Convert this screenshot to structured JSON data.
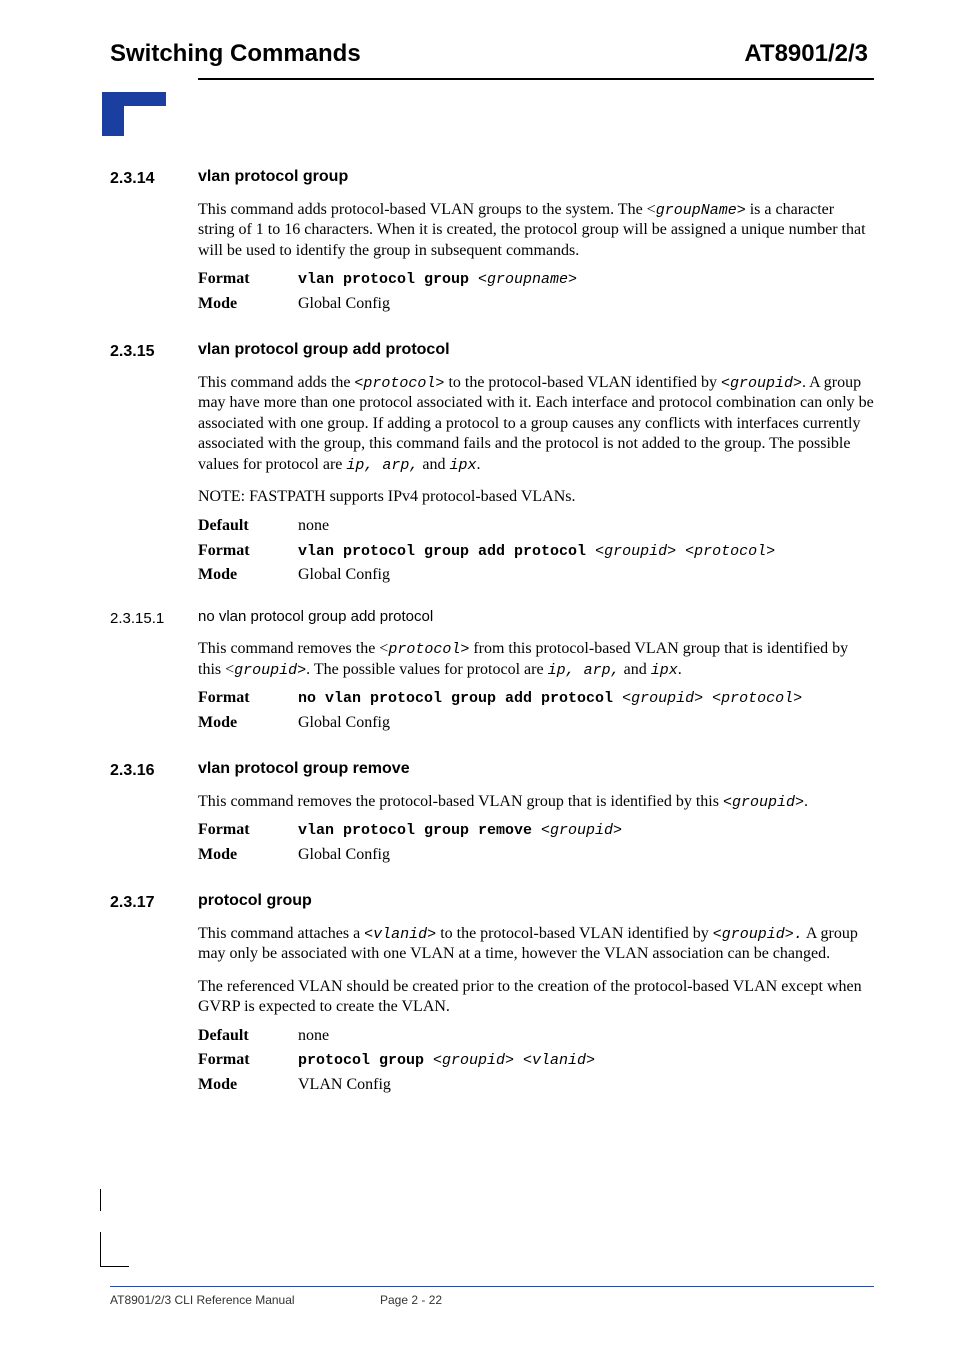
{
  "header": {
    "left": "Switching Commands",
    "right": "AT8901/2/3"
  },
  "sections": {
    "s2314": {
      "num": "2.3.14",
      "title": "vlan protocol group",
      "para1_a": "This command adds protocol-based VLAN groups to the system. The <",
      "para1_code": "groupName>",
      "para1_b": " is a character string of 1 to 16 characters.   When it is created, the protocol group will be assigned a unique number that will be used to identify the group in subsequent commands.",
      "format_label": "Format",
      "format_cmd": "vlan protocol group ",
      "format_arg": "<groupname>",
      "mode_label": "Mode",
      "mode_val": "Global Config"
    },
    "s2315": {
      "num": "2.3.15",
      "title": "vlan protocol group add protocol",
      "para1_a": "This command adds the ",
      "para1_code1": "<protocol>",
      "para1_b": " to the protocol-based VLAN identified by ",
      "para1_code2": "<groupid>",
      "para1_c": ". A group may have more than one protocol associated with it. Each interface and protocol combination can only be associated with one group. If adding a protocol to a group causes any conflicts with interfaces currently associated with the group, this command fails and the protocol is not added to the group. The possible values for protocol are ",
      "para1_code3": "ip, arp,",
      "para1_d": " and ",
      "para1_code4": "ipx",
      "para1_e": ".",
      "note": "NOTE: FASTPATH supports IPv4 protocol-based VLANs.",
      "default_label": "Default",
      "default_val": "none",
      "format_label": "Format",
      "format_cmd": "vlan protocol group add protocol ",
      "format_arg": "<groupid> <protocol>",
      "mode_label": "Mode",
      "mode_val": "Global Config"
    },
    "s23151": {
      "num": "2.3.15.1",
      "title": "no vlan protocol group add protocol",
      "para1_a": "This command removes the <",
      "para1_code1": "protocol>",
      "para1_b": "  from this protocol-based VLAN group that is identified by this <",
      "para1_code2": "groupid>",
      "para1_c": ". The possible values for protocol are ",
      "para1_code3": "ip, arp,",
      "para1_d": " and ",
      "para1_code4": "ipx",
      "para1_e": ".",
      "format_label": "Format",
      "format_cmd": "no vlan protocol group add protocol ",
      "format_arg": "<groupid> <protocol>",
      "mode_label": "Mode",
      "mode_val": "Global Config"
    },
    "s2316": {
      "num": "2.3.16",
      "title": "vlan protocol group remove",
      "para1_a": "This command removes the protocol-based VLAN group that is identified by this ",
      "para1_code1": "<groupid>",
      "para1_b": ".",
      "format_label": "Format",
      "format_cmd": "vlan protocol group remove ",
      "format_arg": "<groupid>",
      "mode_label": "Mode",
      "mode_val": "Global Config"
    },
    "s2317": {
      "num": "2.3.17",
      "title": "protocol group",
      "para1_a": "This command attaches a ",
      "para1_code1": "<vlanid>",
      "para1_b": " to the protocol-based VLAN identified by ",
      "para1_code2": "<groupid>.",
      "para1_c": "   A group may only be associated with one VLAN at a time, however the VLAN association can be changed.",
      "para2": "The referenced VLAN should be created prior to the creation of the protocol-based VLAN except when GVRP is expected to create the VLAN.",
      "default_label": "Default",
      "default_val": "none",
      "format_label": "Format",
      "format_cmd": "protocol group ",
      "format_arg": "<groupid> <vlanid>",
      "mode_label": "Mode",
      "mode_val": "VLAN Config"
    }
  },
  "footer": {
    "left": "AT8901/2/3 CLI Reference Manual",
    "page": "Page 2 - 22"
  }
}
